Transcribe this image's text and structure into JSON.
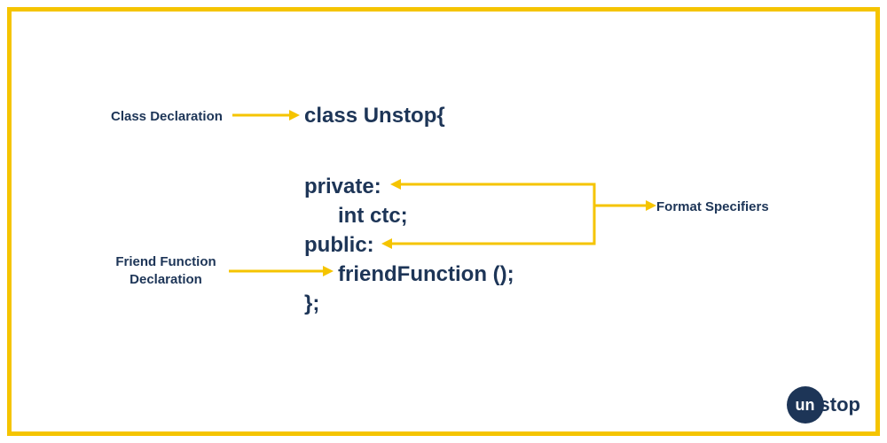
{
  "labels": {
    "class_declaration": "Class Declaration",
    "friend_function_declaration_l1": "Friend Function",
    "friend_function_declaration_l2": "Declaration",
    "format_specifiers": "Format Specifiers"
  },
  "code": {
    "line1": "class Unstop{",
    "line2": "private:",
    "line3": "int ctc;",
    "line4": "public:",
    "line5": "friendFunction ();",
    "line6": "};"
  },
  "logo": {
    "circle_text": "un",
    "rest": "stop"
  },
  "colors": {
    "accent": "#f5c400",
    "text": "#1d3557"
  }
}
